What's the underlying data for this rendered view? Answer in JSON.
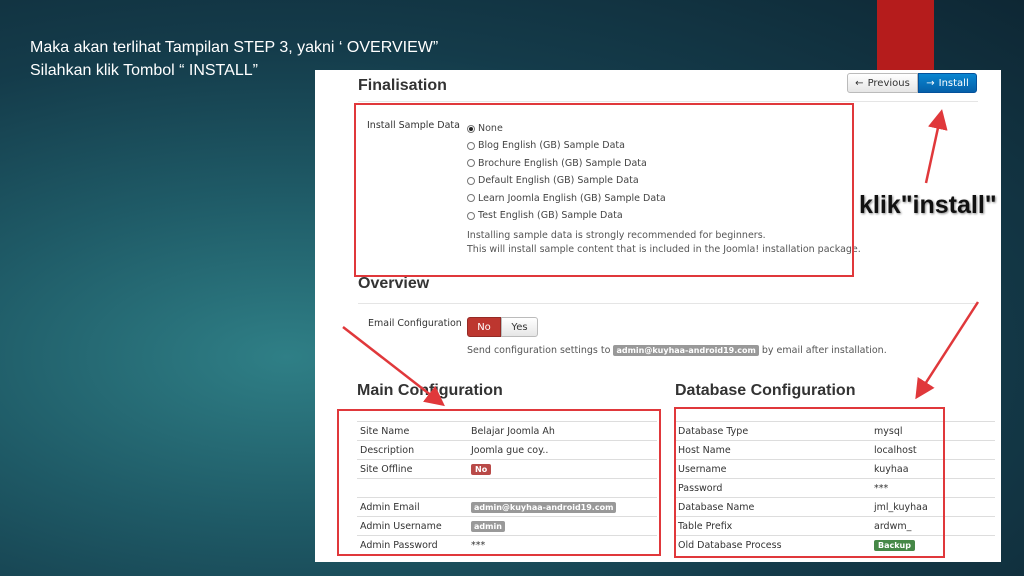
{
  "caption": {
    "line1": "Maka akan terlihat Tampilan STEP 3, yakni  ‘ OVERVIEW”",
    "line2": "Silahkan klik Tombol “ INSTALL”"
  },
  "callout": "klik\"install\"",
  "header": {
    "title": "Finalisation",
    "prev_label": "Previous",
    "install_label": "Install"
  },
  "sample": {
    "label": "Install Sample Data",
    "options": [
      "None",
      "Blog English (GB) Sample Data",
      "Brochure English (GB) Sample Data",
      "Default English (GB) Sample Data",
      "Learn Joomla English (GB) Sample Data",
      "Test English (GB) Sample Data"
    ],
    "selected": "None",
    "help1": "Installing sample data is strongly recommended for beginners.",
    "help2": "This will install sample content that is included in the Joomla! installation package."
  },
  "overview": {
    "title": "Overview",
    "email_label": "Email Configuration",
    "no_label": "No",
    "yes_label": "Yes",
    "email_pre": "Send configuration settings to",
    "email": "admin@kuyhaa-android19.com",
    "email_post": "by email after installation."
  },
  "main_config": {
    "title": "Main Configuration",
    "rows": [
      {
        "label": "Site Name",
        "value": "Belajar Joomla Ah"
      },
      {
        "label": "Description",
        "value": "Joomla gue coy.."
      },
      {
        "label": "Site Offline",
        "value": "No"
      },
      {
        "label": "",
        "value": ""
      },
      {
        "label": "Admin Email",
        "value": "admin@kuyhaa-android19.com"
      },
      {
        "label": "Admin Username",
        "value": "admin"
      },
      {
        "label": "Admin Password",
        "value": "***"
      }
    ]
  },
  "db_config": {
    "title": "Database Configuration",
    "rows": [
      {
        "label": "Database Type",
        "value": "mysql"
      },
      {
        "label": "Host Name",
        "value": "localhost"
      },
      {
        "label": "Username",
        "value": "kuyhaa"
      },
      {
        "label": "Password",
        "value": "***"
      },
      {
        "label": "Database Name",
        "value": "jml_kuyhaa"
      },
      {
        "label": "Table Prefix",
        "value": "ardwm_"
      },
      {
        "label": "Old Database Process",
        "value": "Backup"
      }
    ]
  },
  "colors": {
    "accent_red": "#e0383b",
    "install_blue": "#0560a9",
    "no_red": "#bd362f",
    "badge_green": "#468847"
  }
}
